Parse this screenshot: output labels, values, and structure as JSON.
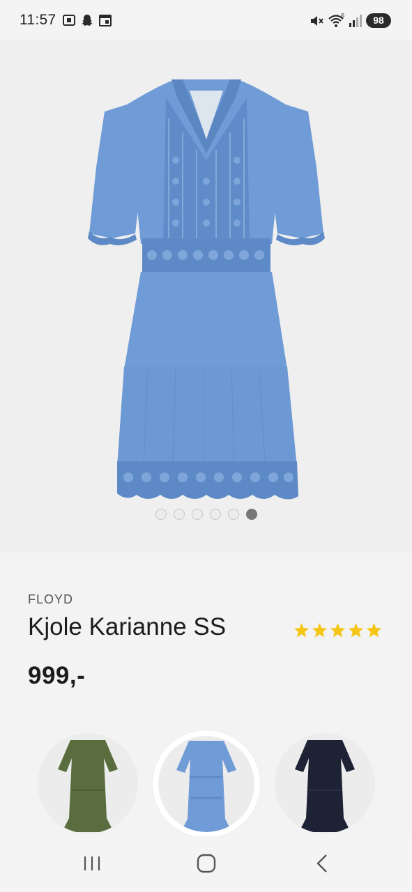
{
  "status_bar": {
    "time": "11:57",
    "battery": "98",
    "icons": [
      "screenshot-icon",
      "snapchat-icon",
      "calendar-icon",
      "mute-icon",
      "wifi-icon",
      "signal-icon"
    ]
  },
  "gallery": {
    "image_count": 6,
    "active_index": 5,
    "dress_color": "#6f9bd6"
  },
  "product": {
    "brand": "FLOYD",
    "name": "Kjole Karianne SS",
    "rating": 5,
    "price": "999,-"
  },
  "variants": [
    {
      "color_name": "green",
      "color": "#5a6d3e",
      "selected": false
    },
    {
      "color_name": "blue",
      "color": "#6f9bd6",
      "selected": true
    },
    {
      "color_name": "navy",
      "color": "#1e2235",
      "selected": false
    }
  ],
  "colors": {
    "star": "#f5c518",
    "background": "#f3f3f3"
  },
  "nav": [
    "recent-apps-icon",
    "home-icon",
    "back-icon"
  ]
}
